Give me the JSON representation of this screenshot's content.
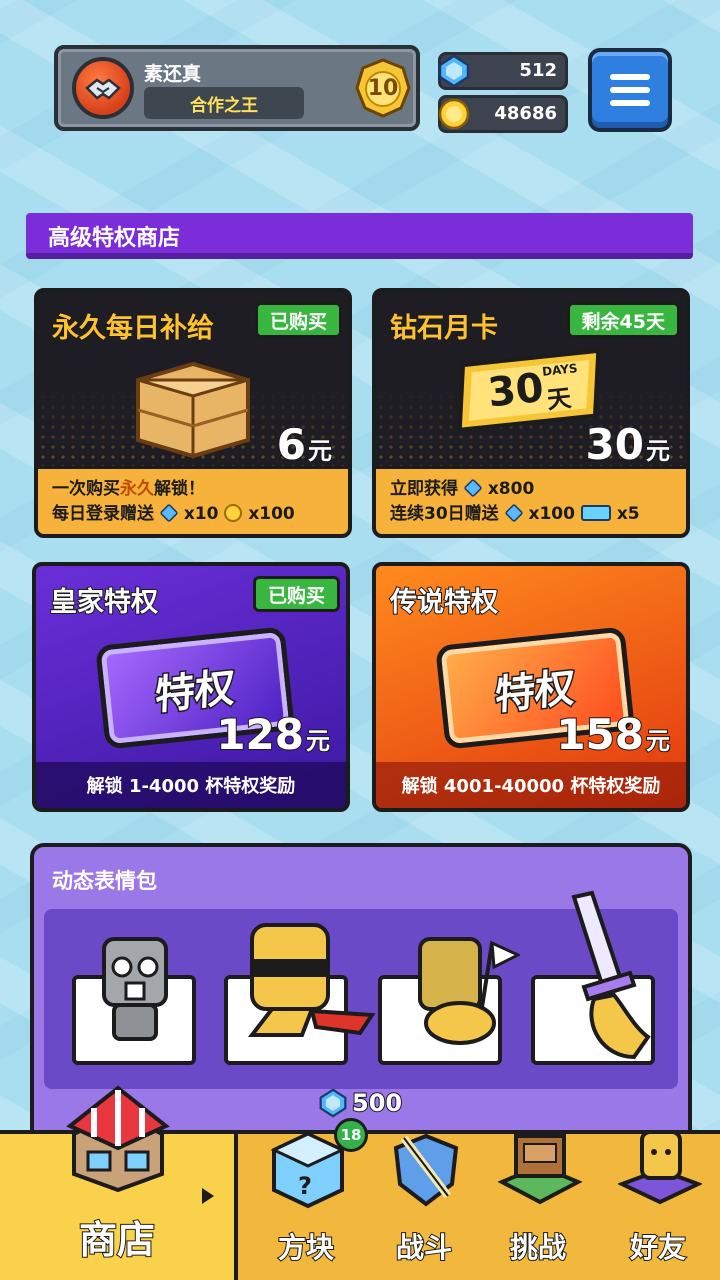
{
  "player": {
    "name": "素还真",
    "title": "合作之王",
    "rank": "10"
  },
  "currency": {
    "gems": "512",
    "coins": "48686"
  },
  "section_title": "高级特权商店",
  "cards": {
    "daily": {
      "title": "永久每日补给",
      "tag": "已购买",
      "price": "6",
      "unit": "元",
      "line1_prefix": "一次购买",
      "line1_highlight": "永久",
      "line1_suffix": "解锁！",
      "line2": "每日登录赠送",
      "gem_amount": "x10",
      "coin_amount": "x100"
    },
    "monthly": {
      "title": "钻石月卡",
      "tag": "剩余45天",
      "badge_days": "30",
      "badge_days_en": "DAYS",
      "badge_day_unit": "天",
      "price": "30",
      "unit": "元",
      "line1": "立即获得",
      "gem_now": "x800",
      "line2": "连续30日赠送",
      "gem_daily": "x100",
      "ticket_daily": "x5"
    },
    "royal": {
      "title": "皇家特权",
      "tag": "已购买",
      "plate_text": "特权",
      "price": "128",
      "unit": "元",
      "strip": "解锁 1-4000 杯特权奖励"
    },
    "legend": {
      "title": "传说特权",
      "plate_text": "特权",
      "price": "158",
      "unit": "元",
      "strip": "解锁 4001-40000 杯特权奖励"
    }
  },
  "emoji_pack": {
    "title": "动态表情包",
    "price": "500",
    "items": [
      "stone-crying-emoji",
      "cool-sunglasses-emoji",
      "white-flag-emoji",
      "sword-emoji"
    ]
  },
  "nav": {
    "shop": "商店",
    "blocks": "方块",
    "blocks_badge": "18",
    "battle": "战斗",
    "challenge": "挑战",
    "friends": "好友"
  },
  "colors": {
    "accent_purple": "#7a2dd9",
    "tag_green": "#38b640",
    "nav_gold": "#f2b83e"
  }
}
